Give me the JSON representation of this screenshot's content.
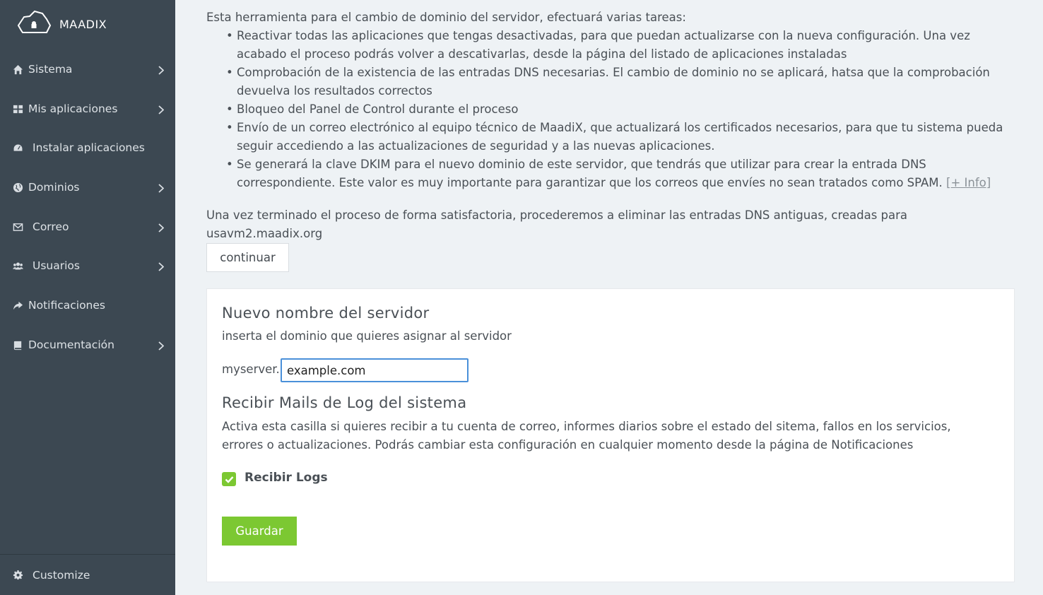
{
  "brand": {
    "name": "MAADIX",
    "icon": "cloud-lock-logo"
  },
  "sidebar": {
    "items": [
      {
        "label": "Sistema",
        "icon": "home-icon",
        "has_submenu": true
      },
      {
        "label": "Mis aplicaciones",
        "icon": "grid-icon",
        "has_submenu": true
      },
      {
        "label": "Instalar aplicaciones",
        "icon": "dashboard-icon",
        "has_submenu": false
      },
      {
        "label": "Dominios",
        "icon": "globe-icon",
        "has_submenu": true
      },
      {
        "label": "Correo",
        "icon": "envelope-icon",
        "has_submenu": true
      },
      {
        "label": "Usuarios",
        "icon": "users-icon",
        "has_submenu": true
      },
      {
        "label": "Notificaciones",
        "icon": "share-arrow-icon",
        "has_submenu": false
      },
      {
        "label": "Documentación",
        "icon": "book-icon",
        "has_submenu": true
      }
    ],
    "customize_label": "Customize"
  },
  "main": {
    "intro_text": "Esta herramienta para el cambio de dominio del servidor, efectuará varias tareas:",
    "tasks": [
      "Reactivar todas las aplicaciones que tengas desactivadas, para que puedan actualizarse con la nueva configuración. Una vez acabado el proceso podrás volver a descativarlas, desde la página del listado de aplicaciones instaladas",
      "Comprobación de la existencia de las entradas DNS necesarias. El cambio de dominio no se aplicará, hatsa que la comprobación devuelva los resultados correctos",
      "Bloqueo del Panel de Control durante el proceso",
      "Envío de un correo electrónico al equipo técnico de MaadiX, que actualizará los certificados necesarios, para que tu sistema pueda seguir accediendo a las actualizaciones de seguridad y a las nuevas aplicaciones."
    ],
    "dkim_task": "Se generará la clave DKIM para el nuevo dominio de este servidor, que tendrás que utilizar para crear la entrada DNS correspondiente. Este valor es muy importante para garantizar que los correos que envíes no sean tratados como SPAM.",
    "info_link": "[+ Info]",
    "after_text": "Una vez terminado el proceso de forma satisfactoria, procederemos a eliminar las entradas DNS antiguas, creadas para usavm2.maadix.org",
    "continue_label": "continuar"
  },
  "form": {
    "server_title": "Nuevo nombre del servidor",
    "server_help": "inserta el dominio que quieres asignar al servidor",
    "prefix": "myserver.",
    "domain_value": "example.com",
    "logs_title": "Recibir Mails de Log del sistema",
    "logs_help": "Activa esta casilla si quieres recibir a tu cuenta de correo, informes diarios sobre el estado del sitema, fallos en los servicios, errores o actualizaciones. Podrás cambiar esta configuración en cualquier momento desde la página de Notificaciones",
    "logs_checkbox_label": "Recibir Logs",
    "logs_checked": true,
    "save_label": "Guardar"
  },
  "colors": {
    "sidebar": "#3c4852",
    "accent_green": "#7cc832",
    "focus_blue": "#4a90d9",
    "background": "#eef2f5"
  }
}
